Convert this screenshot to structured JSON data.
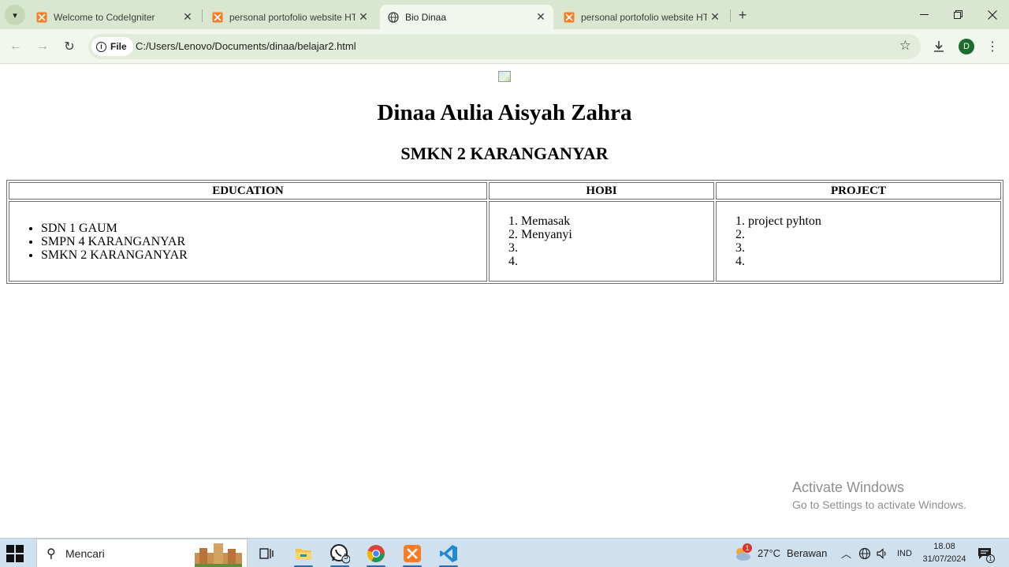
{
  "browser": {
    "tabs": [
      {
        "title": "Welcome to CodeIgniter",
        "icon": "xampp-icon",
        "active": false
      },
      {
        "title": "personal portofolio website HTML",
        "icon": "xampp-icon",
        "active": false
      },
      {
        "title": "Bio Dinaa",
        "icon": "globe-icon",
        "active": true
      },
      {
        "title": "personal portofolio website HTML",
        "icon": "xampp-icon",
        "active": false
      }
    ],
    "address": {
      "chip_label": "File",
      "url": "C:/Users/Lenovo/Documents/dinaa/belajar2.html"
    },
    "profile_initial": "D"
  },
  "page": {
    "name": "Dinaa Aulia Aisyah Zahra",
    "school": "SMKN 2 KARANGANYAR",
    "table": {
      "headers": [
        "EDUCATION",
        "HOBI",
        "PROJECT"
      ],
      "education": [
        "SDN 1 GAUM",
        "SMPN 4 KARANGANYAR",
        "SMKN 2 KARANGANYAR"
      ],
      "hobi": [
        "Memasak",
        "Menyanyi",
        "",
        ""
      ],
      "project": [
        "project pyhton",
        "",
        "",
        ""
      ]
    }
  },
  "watermark": {
    "line1": "Activate Windows",
    "line2": "Go to Settings to activate Windows."
  },
  "taskbar": {
    "search_placeholder": "Mencari",
    "whatsapp_badge": "5",
    "weather": {
      "badge": "1",
      "temp": "27°C",
      "condition": "Berawan"
    },
    "language": "IND",
    "time": "18.08",
    "date": "31/07/2024",
    "notification_count": "1"
  }
}
